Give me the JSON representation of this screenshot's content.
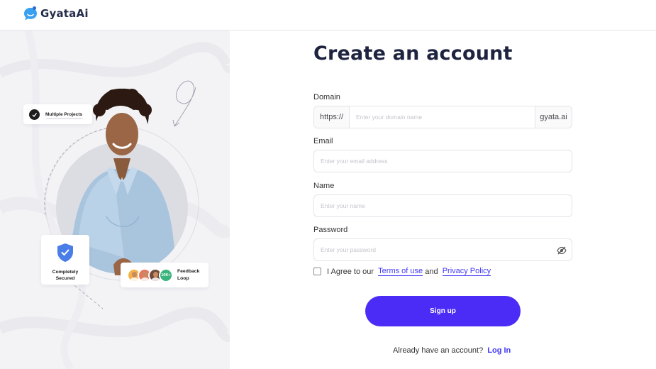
{
  "app": {
    "logo_text": "GyataAi",
    "logo_icon": "chat-bubble-logo"
  },
  "illustration": {
    "projects_card": "Multiple Projects",
    "secured_card": {
      "line1": "Completely",
      "line2": "Secured"
    },
    "feedback_card": {
      "count": "10K+",
      "line1": "Feedback",
      "line2": "Loop"
    }
  },
  "form": {
    "title": "Create an account",
    "domain": {
      "label": "Domain",
      "prefix": "https://",
      "placeholder": "Enter your domain name",
      "suffix": "gyata.ai"
    },
    "email": {
      "label": "Email",
      "placeholder": "Enter your email address"
    },
    "name": {
      "label": "Name",
      "placeholder": "Enter your name"
    },
    "password": {
      "label": "Password",
      "placeholder": "Enter your password",
      "toggle_icon": "eye-off-icon"
    },
    "agree": {
      "text": "I Agree to our",
      "terms": "Terms of use ",
      "and": "and",
      "privacy": "Privacy Policy"
    },
    "signup_label": "Sign up",
    "login": {
      "text": "Already have an account?",
      "link": "Log In"
    }
  },
  "colors": {
    "accent": "#4a2cf6",
    "link": "#4138f5",
    "title": "#1e2340",
    "panel_bg": "#f3f3f6",
    "shield": "#4a7de8"
  }
}
